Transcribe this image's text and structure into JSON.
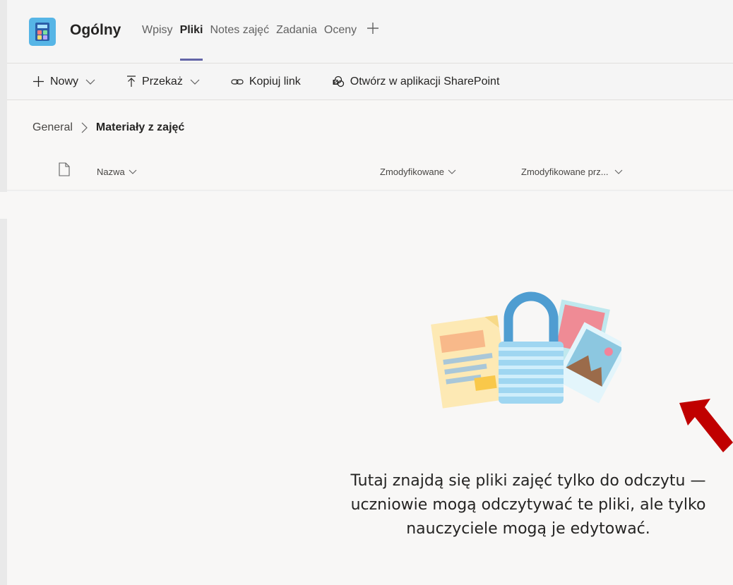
{
  "header": {
    "channel_name": "Ogólny",
    "tabs": [
      {
        "label": "Wpisy",
        "active": false
      },
      {
        "label": "Pliki",
        "active": true
      },
      {
        "label": "Notes zajęć",
        "active": false
      },
      {
        "label": "Zadania",
        "active": false
      },
      {
        "label": "Oceny",
        "active": false
      }
    ],
    "add_tab_icon": "plus-icon"
  },
  "toolbar": {
    "new_label": "Nowy",
    "upload_label": "Przekaż",
    "copy_link_label": "Kopiuj link",
    "sharepoint_label": "Otwórz w aplikacji SharePoint"
  },
  "breadcrumb": {
    "root": "General",
    "current": "Materiały z zajęć"
  },
  "columns": {
    "name": "Nazwa",
    "modified": "Zmodyfikowane",
    "modified_by": "Zmodyfikowane prz..."
  },
  "empty_state": {
    "message": "Tutaj znajdą się pliki zajęć tylko do odczytu — uczniowie mogą odczytywać te pliki, ale tylko nauczyciele mogą je edytować."
  },
  "colors": {
    "accent": "#6264a7",
    "annotation_arrow": "#c00000",
    "team_icon": "#56b5e6"
  }
}
